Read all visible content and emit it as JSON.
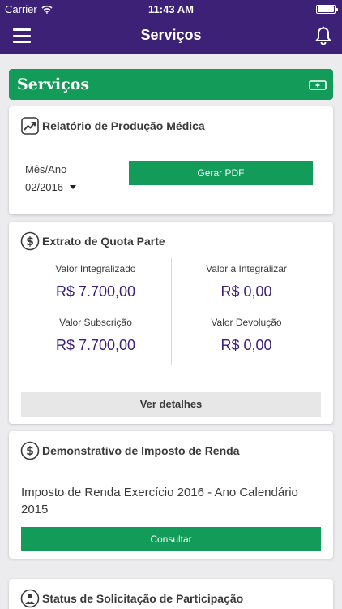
{
  "status_bar": {
    "carrier": "Carrier",
    "time": "11:43 AM"
  },
  "nav": {
    "title": "Serviços",
    "menu_icon": "hamburger-menu-icon",
    "notification_icon": "bell-icon"
  },
  "section_header": {
    "title": "Serviços",
    "add_icon": "add-icon"
  },
  "colors": {
    "primary": "#3d2176",
    "green": "#129b59",
    "background": "#ecebed",
    "grey_button": "#e7e7e7"
  },
  "relatorio": {
    "title": "Relatório de Produção Médica",
    "icon": "chart-line-icon",
    "month_label": "Mês/Ano",
    "month_value": "02/2016",
    "button": "Gerar PDF"
  },
  "quota": {
    "title": "Extrato de Quota Parte",
    "icon": "dollar-circle-icon",
    "items": [
      {
        "label": "Valor Integralizado",
        "value": "R$ 7.700,00"
      },
      {
        "label": "Valor a Integralizar",
        "value": "R$ 0,00"
      },
      {
        "label": "Valor Subscrição",
        "value": "R$ 7.700,00"
      },
      {
        "label": "Valor Devolução",
        "value": "R$ 0,00"
      }
    ],
    "button": "Ver detalhes"
  },
  "irpf": {
    "title": "Demonstrativo de Imposto de Renda",
    "icon": "dollar-circle-icon",
    "text": "Imposto de Renda Exercício 2016 - Ano Calendário 2015",
    "button": "Consultar"
  },
  "status": {
    "title": "Status de Solicitação de Participação",
    "icon": "doctor-icon"
  }
}
